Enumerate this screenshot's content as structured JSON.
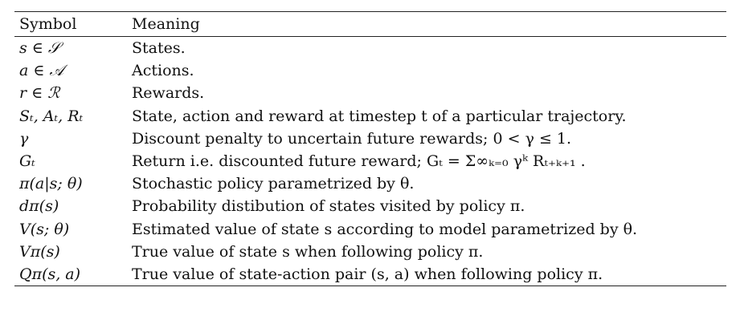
{
  "table": {
    "headers": {
      "symbol": "Symbol",
      "meaning": "Meaning"
    },
    "rows": [
      {
        "symbol": "s ∈ 𝒮",
        "meaning": "States."
      },
      {
        "symbol": "a ∈ 𝒜",
        "meaning": "Actions."
      },
      {
        "symbol": "r ∈ ℛ",
        "meaning": "Rewards."
      },
      {
        "symbol": "Sₜ, Aₜ, Rₜ",
        "meaning": "State, action and reward at timestep t of a particular trajectory."
      },
      {
        "symbol": "γ",
        "meaning": "Discount penalty to uncertain future rewards; 0 < γ ≤ 1."
      },
      {
        "symbol": "Gₜ",
        "meaning": "Return i.e. discounted future reward; Gₜ = Σ∞ₖ₌₀ γᵏ Rₜ₊ₖ₊₁ ."
      },
      {
        "symbol": "π(a|s; θ)",
        "meaning": "Stochastic policy parametrized by θ."
      },
      {
        "symbol": "dπ(s)",
        "meaning": "Probability distibution of states visited by policy π."
      },
      {
        "symbol": "V(s; θ)",
        "meaning": "Estimated value of state s according to model parametrized by θ."
      },
      {
        "symbol": "Vπ(s)",
        "meaning": "True value of state s when following policy π."
      },
      {
        "symbol": "Qπ(s, a)",
        "meaning": "True value of state-action pair (s, a) when following policy π."
      }
    ]
  }
}
